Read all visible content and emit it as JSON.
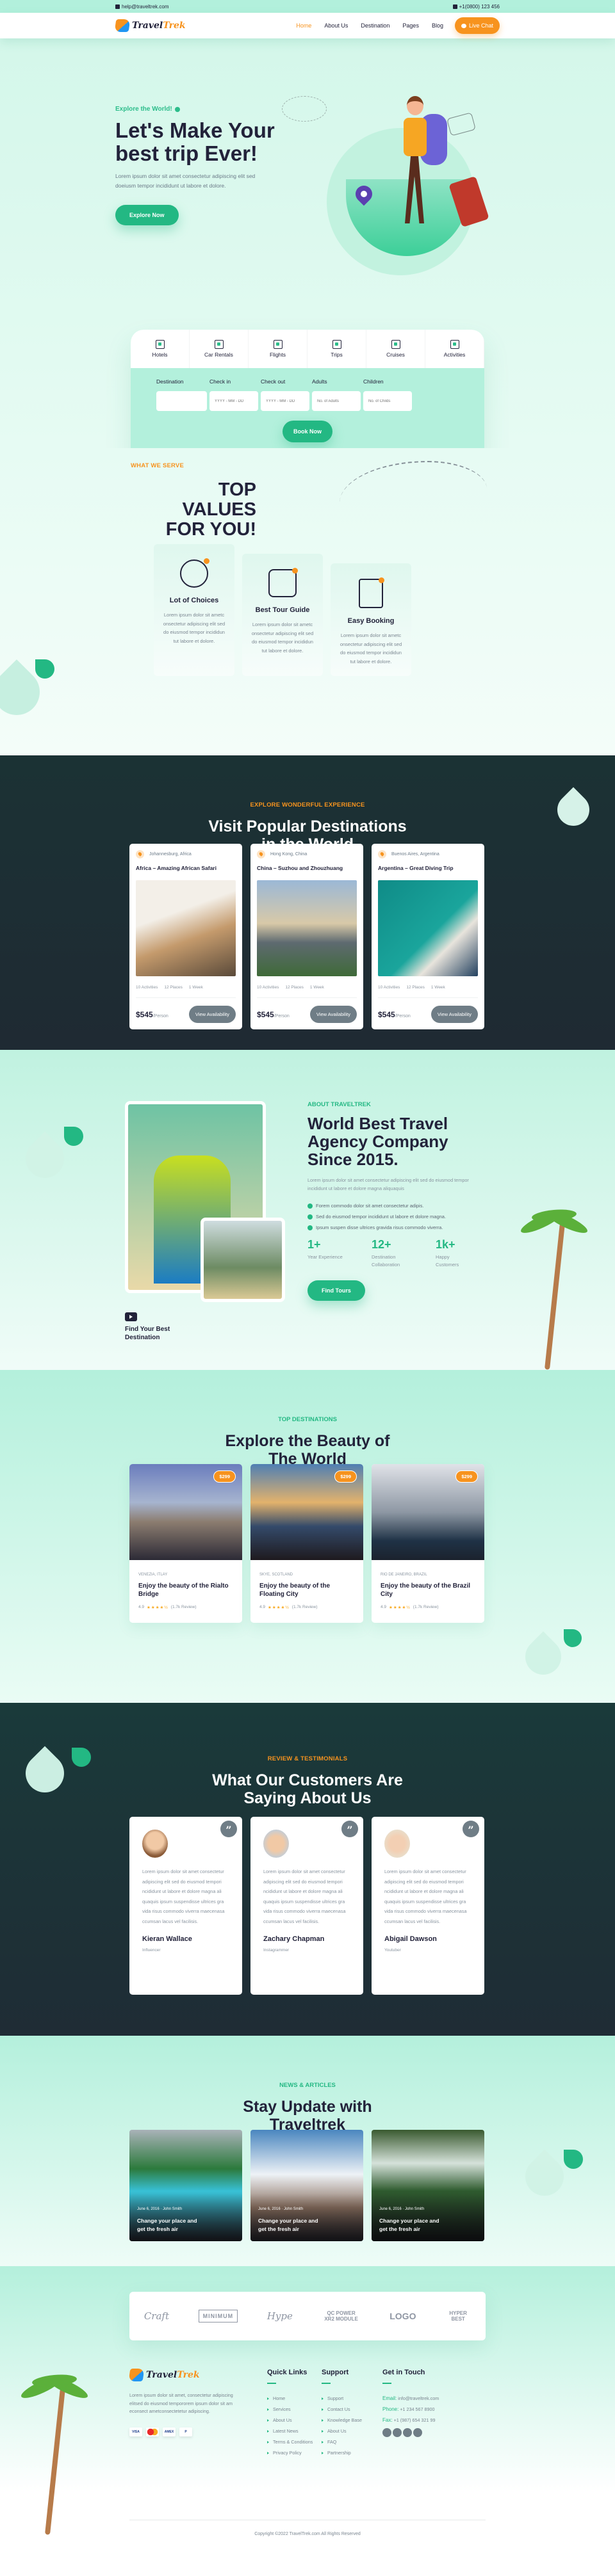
{
  "topbar": {
    "email": "help@traveltrek.com",
    "phone": "+1(0800) 123 456"
  },
  "brand": {
    "name_part1": "Travel",
    "name_part2": "Trek",
    "accent": "#f7931e",
    "primary": "#23b883",
    "dark": "#22223a"
  },
  "nav": {
    "items": [
      {
        "label": "Home",
        "active": true
      },
      {
        "label": "About Us"
      },
      {
        "label": "Destination"
      },
      {
        "label": "Pages"
      },
      {
        "label": "Blog"
      }
    ],
    "cta": "Live Chat"
  },
  "hero": {
    "eyebrow": "Explore the World!",
    "title_line1": "Let's Make Your",
    "title_line2": "best trip Ever!",
    "text": "Lorem ipsum dolor sit amet consectetur adipiscing elit sed doeiusm tempor incididunt ut labore et dolore.",
    "button": "Explore Now"
  },
  "search": {
    "tabs": [
      "Hotels",
      "Car Rentals",
      "Flights",
      "Trips",
      "Cruises",
      "Activities"
    ],
    "fields": [
      {
        "label": "Destination",
        "placeholder": ""
      },
      {
        "label": "Check in",
        "placeholder": "YYYY - MM - DD"
      },
      {
        "label": "Check out",
        "placeholder": "YYYY - MM - DD"
      },
      {
        "label": "Adults",
        "placeholder": "No. of Adults"
      },
      {
        "label": "Children",
        "placeholder": "No. of Childs"
      }
    ],
    "button": "Book Now"
  },
  "values": {
    "eyebrow": "WHAT WE SERVE",
    "title_line1": "TOP VALUES",
    "title_line2": "FOR YOU!",
    "cards": [
      {
        "title": "Lot of Choices",
        "text": "Lorem ipsum dolor sit ametc onsectetur adipiscing elit sed do eiusmod tempor incididun tut labore et dolore."
      },
      {
        "title": "Best Tour Guide",
        "text": "Lorem ipsum dolor sit ametc onsectetur adipiscing elit sed do eiusmod tempor incididun tut labore et dolore."
      },
      {
        "title": "Easy Booking",
        "text": "Lorem ipsum dolor sit ametc onsectetur adipiscing elit sed do eiusmod tempor incididun tut labore et dolore."
      }
    ]
  },
  "popular": {
    "eyebrow": "EXPLORE WONDERFUL EXPERIENCE",
    "title_line1": "Visit Popular Destinations",
    "title_line2": "in the World",
    "cards": [
      {
        "location": "Johannesburg, Africa",
        "title": "Africa – Amazing African Safari",
        "activities": "10 Activities",
        "places": "12 Places",
        "duration": "1 Week",
        "price": "$545",
        "unit": "/Person",
        "button": "View Availability"
      },
      {
        "location": "Hong Kong, China",
        "title": "China – Suzhou and Zhouzhuang",
        "activities": "10 Activities",
        "places": "12 Places",
        "duration": "1 Week",
        "price": "$545",
        "unit": "/Person",
        "button": "View Availability"
      },
      {
        "location": "Buenos Aires, Argentina",
        "title": "Argentina – Great Diving Trip",
        "activities": "10 Activities",
        "places": "12 Places",
        "duration": "1 Week",
        "price": "$545",
        "unit": "/Person",
        "button": "View Availability"
      }
    ]
  },
  "about": {
    "eyebrow": "ABOUT TRAVELTREK",
    "title_line1": "World Best Travel",
    "title_line2": "Agency Company",
    "title_line3": "Since 2015.",
    "text": "Lorem ipsum dolor sit amet consectetur adipiscing elit sed do eiusmod tempor incididunt ut labore et dolore magna aliquaquis",
    "checks": [
      "Forem commodo dolor sit amet consectetur adipis.",
      "Sed do eiusmod tempor incididunt ut labore et dolore magna.",
      "Ipsum suspen disse ultrices gravida risus commodo viverra."
    ],
    "stats": [
      {
        "value": "1+",
        "label": "Year Experience"
      },
      {
        "value": "12+",
        "label": "Destination Collaboration"
      },
      {
        "value": "1k+",
        "label": "Happy Customers"
      }
    ],
    "button": "Find Tours",
    "video_caption": "Find Your Best Destination"
  },
  "topdest": {
    "eyebrow": "TOP DESTINATIONS",
    "title_line1": "Explore the Beauty of",
    "title_line2": "The World",
    "cards": [
      {
        "price": "$299",
        "location": "VENEZIA, ITLAY",
        "title": "Enjoy the beauty of the Rialto Bridge",
        "rating": "4.9",
        "stars": "★★★★½",
        "reviews": "(1.7k Review)"
      },
      {
        "price": "$299",
        "location": "SKYE, SCOTLAND",
        "title": "Enjoy the beauty of the Floating City",
        "rating": "4.9",
        "stars": "★★★★½",
        "reviews": "(1.7k Review)"
      },
      {
        "price": "$299",
        "location": "RIO DE JANEIRO, BRAZIL",
        "title": "Enjoy the beauty of the Brazil City",
        "rating": "4.9",
        "stars": "★★★★½",
        "reviews": "(1.7k Review)"
      }
    ]
  },
  "testimonials": {
    "eyebrow": "REVIEW & TESTIMONIALS",
    "title_line1": "What Our Customers Are",
    "title_line2": "Saying About Us",
    "items": [
      {
        "text": "Lorem ipsum dolor sit amet consectetur adipiscing elit sed do eiusmod tempori ncididunt ut labore et dolore magna ali quaquis ipsum suspendisse ultrices gra vida risus commodo viverra maecenasa ccumsan lacus vel facilisis.",
        "name": "Kieran Wallace",
        "role": "Influencer"
      },
      {
        "text": "Lorem ipsum dolor sit amet consectetur adipiscing elit sed do eiusmod tempori ncididunt ut labore et dolore magna ali quaquis ipsum suspendisse ultrices gra vida risus commodo viverra maecenasa ccumsan lacus vel facilisis.",
        "name": "Zachary Chapman",
        "role": "Instagrammer"
      },
      {
        "text": "Lorem ipsum dolor sit amet consectetur adipiscing elit sed do eiusmod tempori ncididunt ut labore et dolore magna ali quaquis ipsum suspendisse ultrices gra vida risus commodo viverra maecenasa ccumsan lacus vel facilisis.",
        "name": "Abigail Dawson",
        "role": "Youtuber"
      }
    ]
  },
  "news": {
    "eyebrow": "NEWS & ARTICLES",
    "title_line1": "Stay Update with",
    "title_line2": "Traveltrek",
    "items": [
      {
        "meta": "June 6, 2016 · John Smith",
        "title": "Change your place and get the fresh air"
      },
      {
        "meta": "June 6, 2016 · John Smith",
        "title": "Change your place and get the fresh air"
      },
      {
        "meta": "June 6, 2016 · John Smith",
        "title": "Change your place and get the fresh air"
      }
    ]
  },
  "footer": {
    "brands": [
      "Craft",
      "MINIMUM",
      "Hype",
      "QC POWER XR2 MODULE",
      "LOGO",
      "HYPER BEST"
    ],
    "about": "Lorem ipsum dolor sit amet, consectetur adipiscing elitsed do eiusmod tempororem ipsum dolor sit am econsect ametconsectetetur adipiscing.",
    "payments": [
      "VISA",
      "MC",
      "AMEX",
      "P"
    ],
    "quick_links": {
      "title": "Quick Links",
      "items": [
        "Home",
        "Services",
        "About Us",
        "Latest News",
        "Terms & Conditions",
        "Privacy Policy"
      ]
    },
    "support": {
      "title": "Support",
      "items": [
        "Support",
        "Contact Us",
        "Knowledge Base",
        "About Us",
        "FAQ",
        "Partnership"
      ]
    },
    "contact": {
      "title": "Get in Touch",
      "email_label": "Email:",
      "email": "info@traveltrek.com",
      "phone_label": "Phone:",
      "phone": "+1 234 567 8900",
      "fax_label": "Fax:",
      "fax": "+1 (987) 654 321 99",
      "socials": [
        "facebook",
        "twitter",
        "linkedin",
        "pinterest"
      ]
    },
    "copyright": "Copyright ©2022 TravelTrek.com All Rights Reserved"
  }
}
